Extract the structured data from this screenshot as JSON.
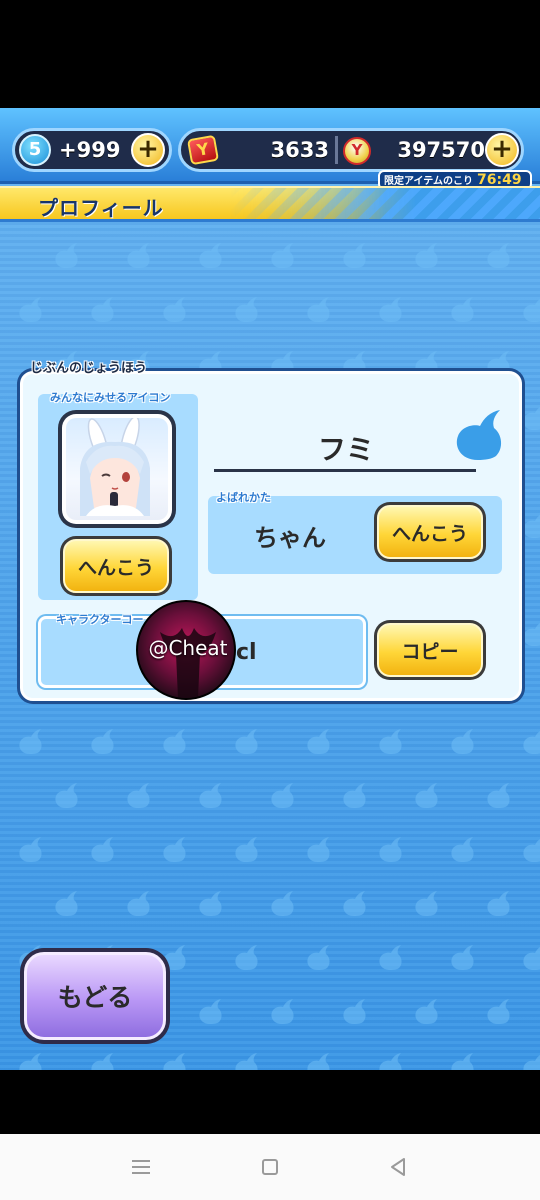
{
  "topbar": {
    "stamina_level": "5",
    "stamina_value": "+999",
    "medal_value": "3633",
    "coin_value": "397570",
    "limited_label": "限定アイテムのこり",
    "limited_timer": "76:49"
  },
  "title": "プロフィール",
  "profile": {
    "section_label": "じぶんのじょうほう",
    "icon_label": "みんなにみせるアイコン",
    "change_icon_label": "へんこう",
    "name": "フミ",
    "call_label": "よばれかた",
    "call_value": "ちゃん",
    "change_call_label": "へんこう",
    "code_label": "キャラクターコー",
    "code_value": "cl",
    "copy_label": "コピー"
  },
  "watermark": "@Cheat",
  "back_label": "もどる",
  "colors": {
    "accent_yellow": "#ffd638",
    "panel_bg": "#eaf8ff",
    "field_bg": "#a8dcff",
    "sky_blue": "#3f9be8",
    "back_purple": "#b997f5"
  },
  "icons": [
    "stamina-badge-icon",
    "plus-icon",
    "medal-icon",
    "coin-icon",
    "spirit-icon",
    "menu-icon",
    "home-icon",
    "back-icon"
  ]
}
